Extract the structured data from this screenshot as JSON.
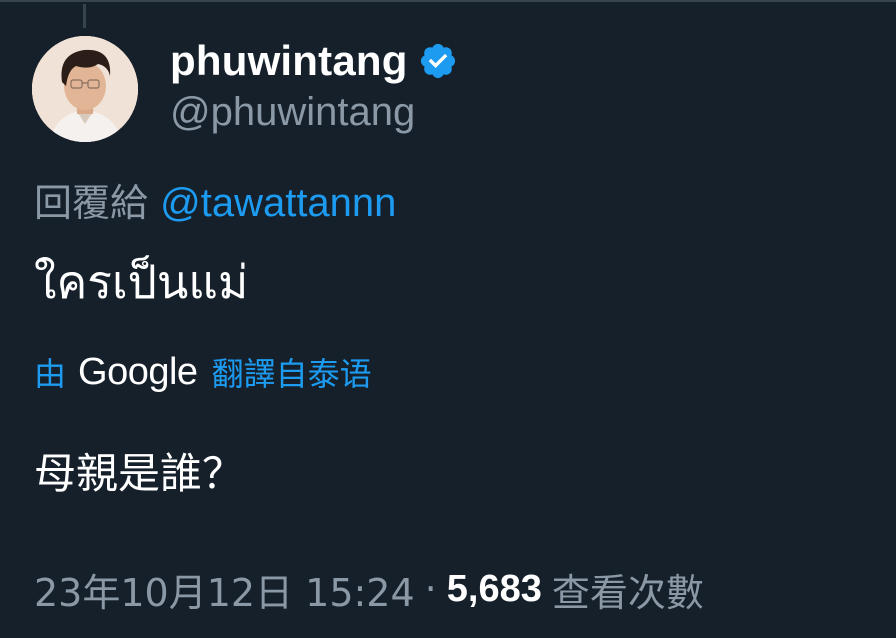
{
  "tweet": {
    "author": {
      "display_name": "phuwintang",
      "handle": "@phuwintang",
      "verified_icon": "verified-badge-icon",
      "verified_color": "#1d9bf0"
    },
    "reply_to": {
      "prefix": "回覆給",
      "mention": "@tawattannn"
    },
    "text": "ใครเป็นแม่",
    "translation": {
      "by": "由",
      "provider": "Google",
      "link_text": "翻譯自泰语",
      "translated_text": "母親是誰？"
    },
    "meta": {
      "timestamp": "23年10月12日 15:24",
      "separator": "·",
      "views_count": "5,683",
      "views_label": "查看次數"
    }
  },
  "colors": {
    "background": "#15202b",
    "primary_text": "#ffffff",
    "secondary_text": "#8b98a5",
    "accent": "#1d9bf0"
  }
}
